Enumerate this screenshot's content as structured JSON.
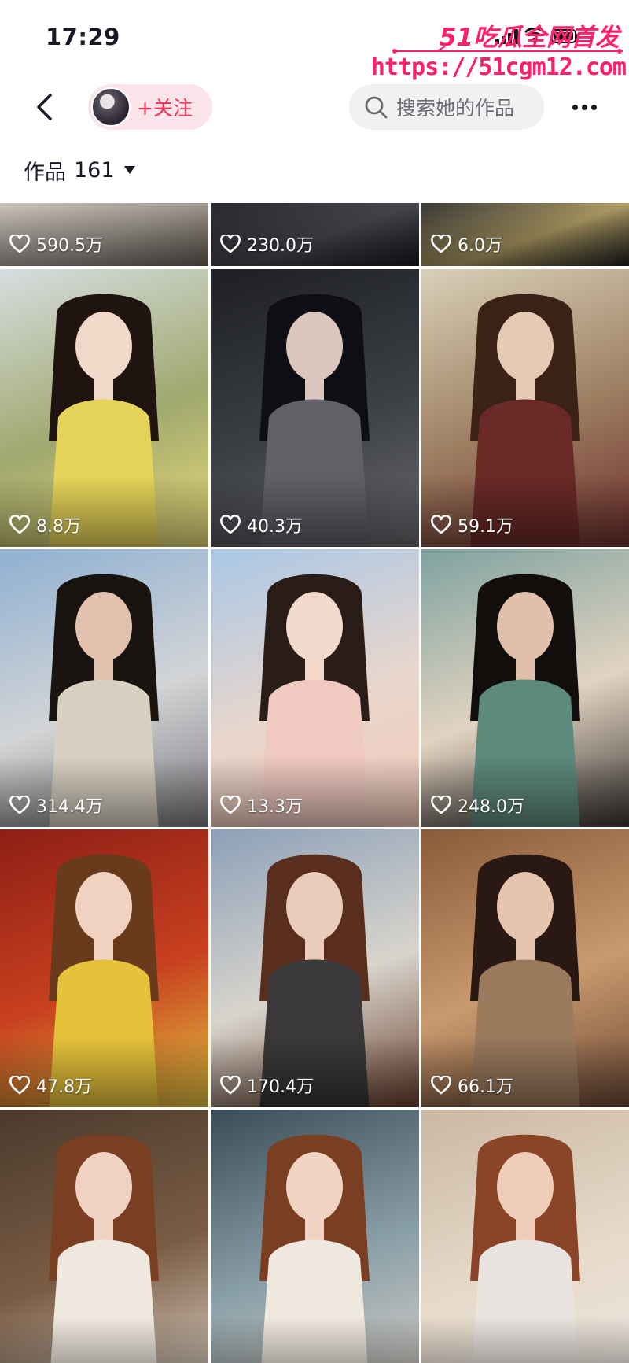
{
  "status_bar": {
    "time": "17:29"
  },
  "watermark": {
    "brand": "51吃瓜全网首发",
    "url": "https://51cgm12.com"
  },
  "nav": {
    "follow_label": "+关注",
    "search_placeholder": "搜索她的作品"
  },
  "works_tab": {
    "label": "作品",
    "count": "161"
  },
  "colors": {
    "accent": "#fe2c55",
    "chip_bg": "#fbe4ea",
    "search_bg": "#f1f1f2",
    "watermark": "#ff1f6b"
  },
  "icons": [
    "back-arrow-icon",
    "search-icon",
    "more-dots-icon",
    "caret-down-icon",
    "heart-icon"
  ],
  "videos": [
    {
      "likes": "590.5万",
      "palette": [
        "#d9d2c8",
        "#a8a098",
        "#6d645c"
      ],
      "fig": "none"
    },
    {
      "likes": "230.0万",
      "palette": [
        "#2b2c31",
        "#4a4b52",
        "#1a1b20"
      ],
      "fig": "none"
    },
    {
      "likes": "6.0万",
      "palette": [
        "#3a3a3a",
        "#b9a66a",
        "#202020"
      ],
      "fig": "none"
    },
    {
      "likes": "8.8万",
      "palette": [
        "#d7dde0",
        "#9fa86e",
        "#e9dc79"
      ],
      "fig": "yellow"
    },
    {
      "likes": "40.3万",
      "palette": [
        "#1d1f22",
        "#3c3f44",
        "#696a6e"
      ],
      "fig": "gray"
    },
    {
      "likes": "59.1万",
      "palette": [
        "#d8d0b8",
        "#9c7d60",
        "#6e2f2c"
      ],
      "fig": "maroon"
    },
    {
      "likes": "314.4万",
      "palette": [
        "#8fb0d2",
        "#d2d4d6",
        "#7b7d80"
      ],
      "fig": "cream"
    },
    {
      "likes": "13.3万",
      "palette": [
        "#a9c7e6",
        "#e8d6cc",
        "#f2c9b8"
      ],
      "fig": "pink"
    },
    {
      "likes": "248.0万",
      "palette": [
        "#7fa2a0",
        "#e1d3c0",
        "#3a3634"
      ],
      "fig": "striped"
    },
    {
      "likes": "47.8万",
      "palette": [
        "#8e1e15",
        "#c8401f",
        "#e2c340"
      ],
      "fig": "yellowdress"
    },
    {
      "likes": "170.4万",
      "palette": [
        "#8ca0b8",
        "#d8d4cc",
        "#6b4230"
      ],
      "fig": "plaid"
    },
    {
      "likes": "66.1万",
      "palette": [
        "#8b5a3a",
        "#c99a6e",
        "#6e4a36"
      ],
      "fig": "leopard"
    },
    {
      "likes": "",
      "palette": [
        "#4a3a2c",
        "#7a5c44",
        "#d9cfc2"
      ],
      "fig": "white"
    },
    {
      "likes": "",
      "palette": [
        "#3a4c58",
        "#8aa0a8",
        "#d6cdc6"
      ],
      "fig": "white"
    },
    {
      "likes": "",
      "palette": [
        "#c9b8a2",
        "#e6d9c8",
        "#ece7e2"
      ],
      "fig": "tee"
    }
  ]
}
